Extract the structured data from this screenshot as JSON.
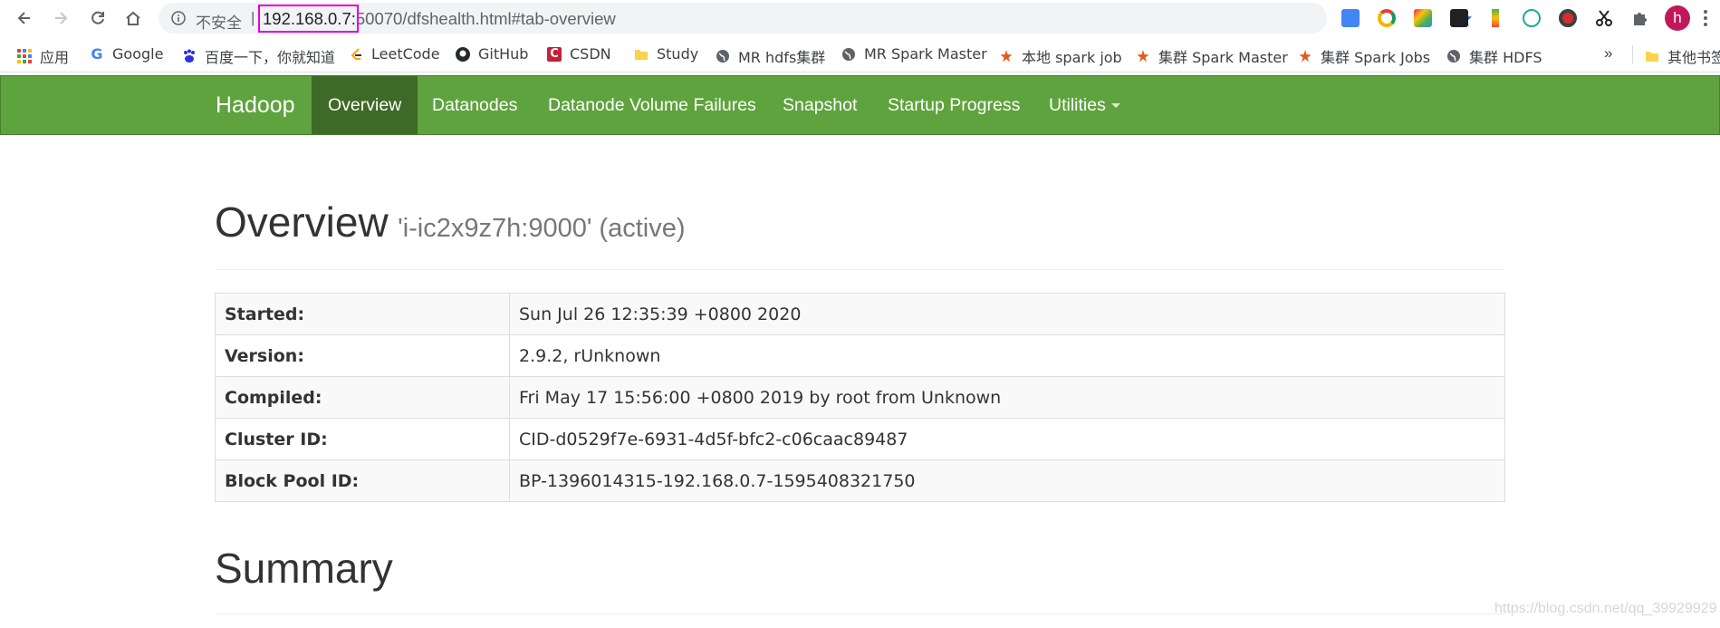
{
  "browser": {
    "security_label": "不安全",
    "separator": "|",
    "url_host": "192.168.0.7:",
    "url_rest": "50070/dfshealth.html#tab-overview",
    "avatar_letter": "h",
    "bookmarks_more": "»",
    "bookmarks": [
      {
        "label": "应用",
        "icon": "apps-grid-icon"
      },
      {
        "label": "Google",
        "icon": "google-icon"
      },
      {
        "label": "百度一下，你就知道",
        "icon": "baidu-paw-icon"
      },
      {
        "label": "LeetCode",
        "icon": "leetcode-icon"
      },
      {
        "label": "GitHub",
        "icon": "github-icon"
      },
      {
        "label": "CSDN",
        "icon": "csdn-icon"
      },
      {
        "label": "Study",
        "icon": "folder-icon"
      },
      {
        "label": "MR hdfs集群",
        "icon": "globe-icon"
      },
      {
        "label": "MR Spark Master",
        "icon": "globe-icon"
      },
      {
        "label": "本地 spark job",
        "icon": "spark-icon"
      },
      {
        "label": "集群 Spark Master",
        "icon": "spark-icon"
      },
      {
        "label": "集群 Spark Jobs",
        "icon": "spark-icon"
      },
      {
        "label": "集群 HDFS",
        "icon": "globe-icon"
      },
      {
        "label": "其他书签",
        "icon": "folder-icon"
      }
    ]
  },
  "navbar": {
    "brand": "Hadoop",
    "items": [
      {
        "label": "Overview",
        "active": true
      },
      {
        "label": "Datanodes"
      },
      {
        "label": "Datanode Volume Failures"
      },
      {
        "label": "Snapshot"
      },
      {
        "label": "Startup Progress"
      },
      {
        "label": "Utilities"
      }
    ]
  },
  "overview": {
    "title": "Overview",
    "subtitle": "'i-ic2x9z7h:9000' (active)",
    "rows": [
      {
        "label": "Started:",
        "value": "Sun Jul 26 12:35:39 +0800 2020"
      },
      {
        "label": "Version:",
        "value": "2.9.2, rUnknown"
      },
      {
        "label": "Compiled:",
        "value": "Fri May 17 15:56:00 +0800 2019 by root from Unknown"
      },
      {
        "label": "Cluster ID:",
        "value": "CID-d0529f7e-6931-4d5f-bfc2-c06caac89487"
      },
      {
        "label": "Block Pool ID:",
        "value": "BP-1396014315-192.168.0.7-1595408321750"
      }
    ]
  },
  "summary": {
    "title": "Summary"
  },
  "watermark": "https://blog.csdn.net/qq_39929929",
  "colors": {
    "navbar": "#5fa33e",
    "nav_active": "#3d6a26",
    "url_highlight": "#e100e1"
  }
}
